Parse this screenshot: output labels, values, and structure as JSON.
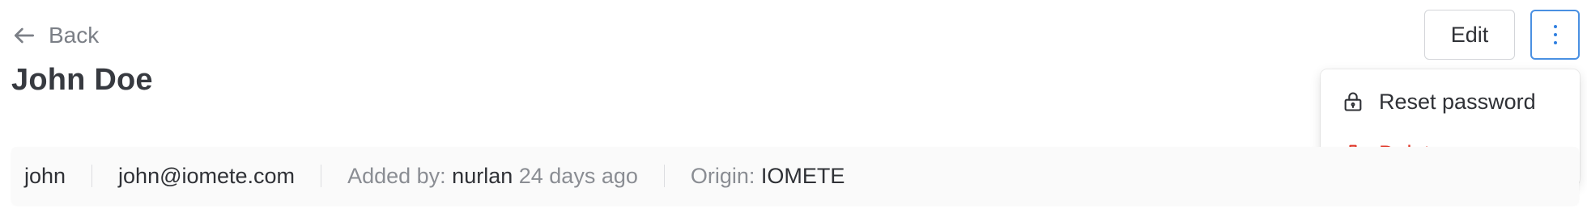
{
  "nav": {
    "back_label": "Back",
    "back_icon": "arrow-left-icon"
  },
  "page": {
    "title": "John Doe"
  },
  "actions": {
    "edit_label": "Edit",
    "more_icon": "more-vertical-icon"
  },
  "menu": {
    "items": [
      {
        "label": "Reset password",
        "icon": "lock-icon",
        "color": "#2f3136"
      },
      {
        "label": "Delete user",
        "icon": "trash-icon",
        "color": "#e0392b"
      }
    ]
  },
  "info": {
    "username": "john",
    "email": "john@iomete.com",
    "added_by_label": "Added by:",
    "added_by_user": "nurlan",
    "added_ago": "24 days ago",
    "origin_label": "Origin:",
    "origin_value": "IOMETE"
  },
  "colors": {
    "accent": "#4a90e2",
    "danger": "#e0392b"
  }
}
